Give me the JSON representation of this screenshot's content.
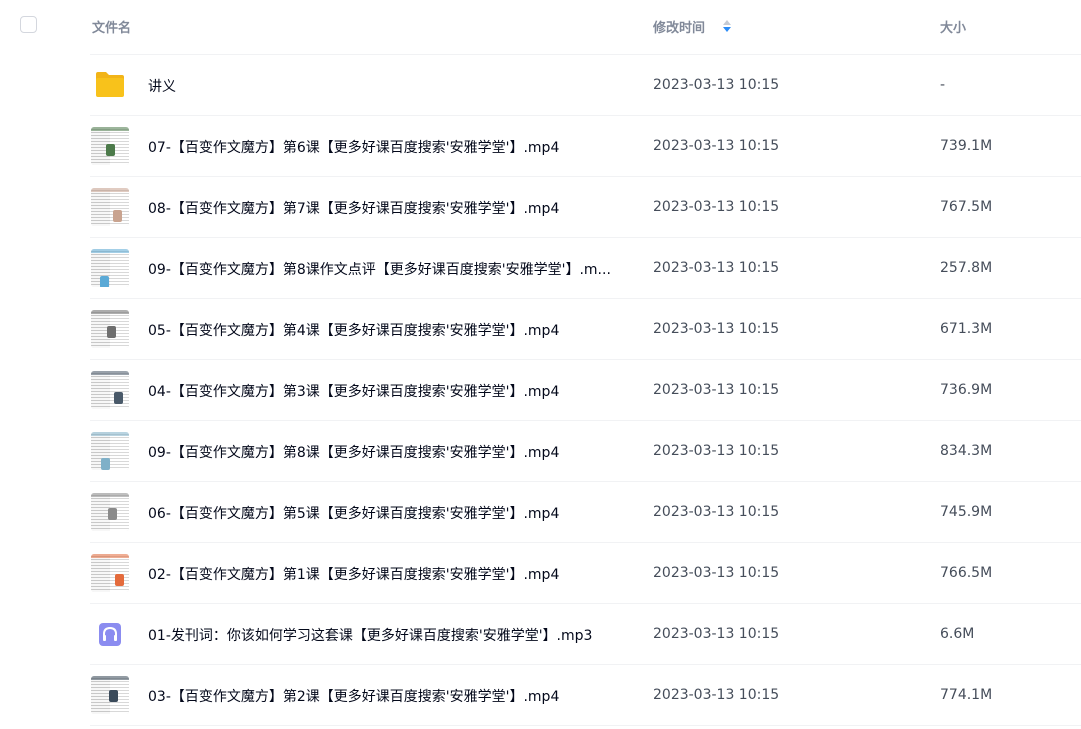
{
  "header": {
    "name_label": "文件名",
    "time_label": "修改时间",
    "size_label": "大小"
  },
  "files": [
    {
      "name": "讲义",
      "time": "2023-03-13 10:15",
      "size": "-",
      "type": "folder",
      "accent": "#f8c21b"
    },
    {
      "name": "07-【百变作文魔方】第6课【更多好课百度搜索'安雅学堂'】.mp4",
      "time": "2023-03-13 10:15",
      "size": "739.1M",
      "type": "video",
      "accent": "#4c7a4a"
    },
    {
      "name": "08-【百变作文魔方】第7课【更多好课百度搜索'安雅学堂'】.mp4",
      "time": "2023-03-13 10:15",
      "size": "767.5M",
      "type": "video",
      "accent": "#c9a38f"
    },
    {
      "name": "09-【百变作文魔方】第8课作文点评【更多好课百度搜索'安雅学堂'】.m...",
      "time": "2023-03-13 10:15",
      "size": "257.8M",
      "type": "video",
      "accent": "#5aa9d6"
    },
    {
      "name": "05-【百变作文魔方】第4课【更多好课百度搜索'安雅学堂'】.mp4",
      "time": "2023-03-13 10:15",
      "size": "671.3M",
      "type": "video",
      "accent": "#6e6e6e"
    },
    {
      "name": "04-【百变作文魔方】第3课【更多好课百度搜索'安雅学堂'】.mp4",
      "time": "2023-03-13 10:15",
      "size": "736.9M",
      "type": "video",
      "accent": "#4a5a6a"
    },
    {
      "name": "09-【百变作文魔方】第8课【更多好课百度搜索'安雅学堂'】.mp4",
      "time": "2023-03-13 10:15",
      "size": "834.3M",
      "type": "video",
      "accent": "#7fb0c8"
    },
    {
      "name": "06-【百变作文魔方】第5课【更多好课百度搜索'安雅学堂'】.mp4",
      "time": "2023-03-13 10:15",
      "size": "745.9M",
      "type": "video",
      "accent": "#8a8a8a"
    },
    {
      "name": "02-【百变作文魔方】第1课【更多好课百度搜索'安雅学堂'】.mp4",
      "time": "2023-03-13 10:15",
      "size": "766.5M",
      "type": "video",
      "accent": "#e46b3c"
    },
    {
      "name": "01-发刊词：你该如何学习这套课【更多好课百度搜索'安雅学堂'】.mp3",
      "time": "2023-03-13 10:15",
      "size": "6.6M",
      "type": "audio",
      "accent": "#8b8cf0"
    },
    {
      "name": "03-【百变作文魔方】第2课【更多好课百度搜索'安雅学堂'】.mp4",
      "time": "2023-03-13 10:15",
      "size": "774.1M",
      "type": "video",
      "accent": "#3a4a5a"
    }
  ]
}
